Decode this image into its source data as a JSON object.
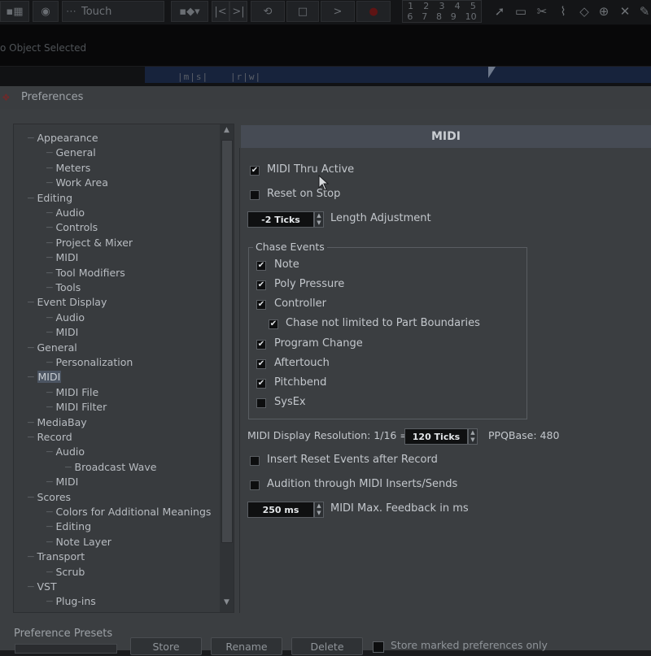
{
  "toolbar": {
    "automation_mode": "Touch",
    "counter_top": [
      "1",
      "2",
      "3",
      "4",
      "5"
    ],
    "counter_bottom": [
      "6",
      "7",
      "8",
      "9",
      "10"
    ]
  },
  "status": {
    "selection": "o Object Selected"
  },
  "ruler": {
    "buttons_left": "|m|s|",
    "buttons_right": "|r|w|"
  },
  "window": {
    "title": "Preferences"
  },
  "tree": {
    "items": [
      {
        "label": "Appearance",
        "level": 0
      },
      {
        "label": "General",
        "level": 1
      },
      {
        "label": "Meters",
        "level": 1
      },
      {
        "label": "Work Area",
        "level": 1
      },
      {
        "label": "Editing",
        "level": 0
      },
      {
        "label": "Audio",
        "level": 1
      },
      {
        "label": "Controls",
        "level": 1
      },
      {
        "label": "Project & Mixer",
        "level": 1
      },
      {
        "label": "MIDI",
        "level": 1
      },
      {
        "label": "Tool Modifiers",
        "level": 1
      },
      {
        "label": "Tools",
        "level": 1
      },
      {
        "label": "Event Display",
        "level": 0
      },
      {
        "label": "Audio",
        "level": 1
      },
      {
        "label": "MIDI",
        "level": 1
      },
      {
        "label": "General",
        "level": 0
      },
      {
        "label": "Personalization",
        "level": 1
      },
      {
        "label": "MIDI",
        "level": 0,
        "selected": true
      },
      {
        "label": "MIDI File",
        "level": 1
      },
      {
        "label": "MIDI Filter",
        "level": 1
      },
      {
        "label": "MediaBay",
        "level": 0
      },
      {
        "label": "Record",
        "level": 0
      },
      {
        "label": "Audio",
        "level": 1
      },
      {
        "label": "Broadcast Wave",
        "level": 2
      },
      {
        "label": "MIDI",
        "level": 1
      },
      {
        "label": "Scores",
        "level": 0
      },
      {
        "label": "Colors for Additional Meanings",
        "level": 1
      },
      {
        "label": "Editing",
        "level": 1
      },
      {
        "label": "Note Layer",
        "level": 1
      },
      {
        "label": "Transport",
        "level": 0
      },
      {
        "label": "Scrub",
        "level": 1
      },
      {
        "label": "VST",
        "level": 0
      },
      {
        "label": "Plug-ins",
        "level": 1
      }
    ]
  },
  "midi": {
    "header": "MIDI",
    "thru_active": {
      "label": "MIDI Thru Active",
      "checked": true
    },
    "reset_on_stop": {
      "label": "Reset on Stop",
      "checked": false
    },
    "length_adjustment": {
      "value": "-2 Ticks",
      "label": "Length Adjustment"
    },
    "chase": {
      "title": "Chase Events",
      "items": [
        {
          "label": "Note",
          "checked": true,
          "indent": false
        },
        {
          "label": "Poly Pressure",
          "checked": true,
          "indent": false
        },
        {
          "label": "Controller",
          "checked": true,
          "indent": false
        },
        {
          "label": "Chase not limited to Part Boundaries",
          "checked": true,
          "indent": true
        },
        {
          "label": "Program Change",
          "checked": true,
          "indent": false
        },
        {
          "label": "Aftertouch",
          "checked": true,
          "indent": false
        },
        {
          "label": "Pitchbend",
          "checked": true,
          "indent": false
        },
        {
          "label": "SysEx",
          "checked": false,
          "indent": false
        }
      ]
    },
    "display_resolution": {
      "label": "MIDI Display Resolution: 1/16 =",
      "value": "120 Ticks",
      "ppq": "PPQBase: 480"
    },
    "insert_reset": {
      "label": "Insert Reset Events after Record",
      "checked": false
    },
    "audition": {
      "label": "Audition through MIDI Inserts/Sends",
      "checked": false
    },
    "feedback": {
      "value": "250 ms",
      "label": "MIDI Max. Feedback in ms"
    }
  },
  "presets": {
    "label": "Preference Presets",
    "store": "Store",
    "rename": "Rename",
    "delete": "Delete",
    "store_marked": "Store marked preferences only"
  },
  "colors": {
    "selection_bg": "#4c5562",
    "header_bg": "#464b54",
    "panel_bg": "#3b3e41"
  }
}
